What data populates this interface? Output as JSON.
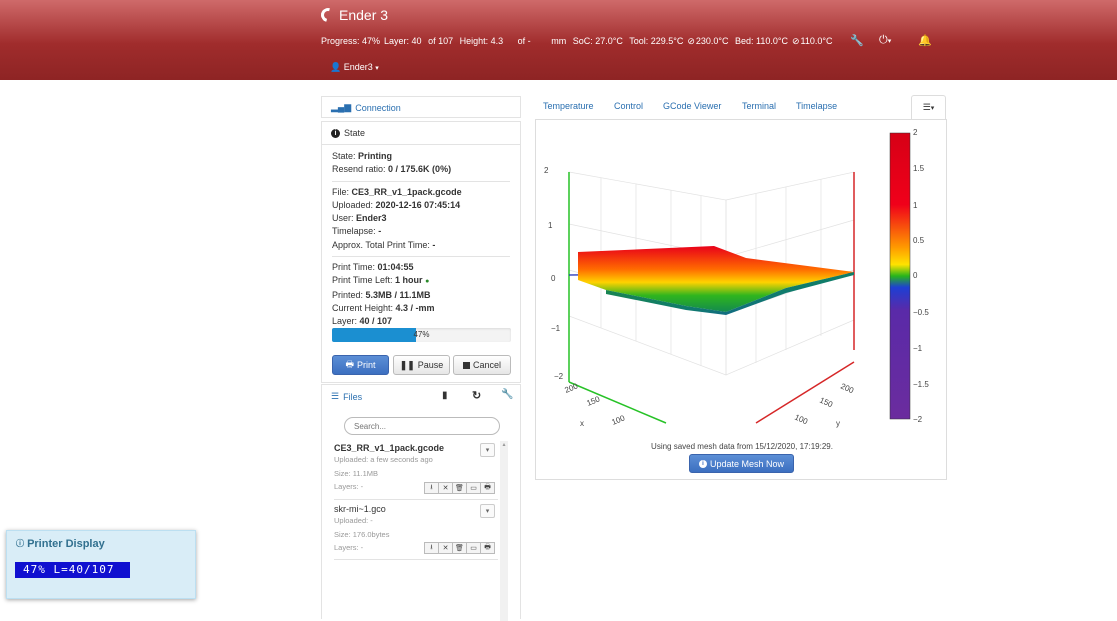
{
  "header": {
    "title": "Ender 3",
    "status": {
      "progress": "Progress: 47%",
      "layer": "Layer: 40",
      "of_layers": "of 107",
      "height": "Height: 4.3",
      "of_height": "of -",
      "unit": "mm",
      "soc": "SoC: 27.0°C",
      "tool": "Tool: 229.5°C",
      "tool_target": "230.0°C",
      "bed": "Bed: 110.0°C",
      "bed_target": "110.0°C"
    },
    "user": "Ender3"
  },
  "connection": {
    "title": "Connection"
  },
  "state": {
    "title": "State",
    "rows": [
      {
        "label": "State: ",
        "value": "Printing"
      },
      {
        "label": "Resend ratio: ",
        "value": "0 / 175.6K (0%)"
      },
      {
        "label": "File: ",
        "value": "CE3_RR_v1_1pack.gcode"
      },
      {
        "label": "Uploaded: ",
        "value": "2020-12-16 07:45:14"
      },
      {
        "label": "User: ",
        "value": "Ender3"
      },
      {
        "label": "Timelapse: ",
        "value": "-"
      },
      {
        "label": "Approx. Total Print Time: ",
        "value": "-"
      },
      {
        "label": "Print Time: ",
        "value": "01:04:55"
      },
      {
        "label": "Print Time Left: ",
        "value": "1 hour"
      },
      {
        "label": "Printed: ",
        "value": "5.3MB / 11.1MB"
      },
      {
        "label": "Current Height: ",
        "value": "4.3 / -mm"
      },
      {
        "label": "Layer: ",
        "value": "40 / 107"
      }
    ],
    "progress_percent": 47,
    "progress_label": "47%",
    "buttons": {
      "print": "Print",
      "pause": "Pause",
      "cancel": "Cancel"
    }
  },
  "files": {
    "title": "Files",
    "search_placeholder": "Search...",
    "items": [
      {
        "name": "CE3_RR_v1_1pack.gcode",
        "uploaded": "Uploaded: a few seconds ago",
        "size": "Size: 11.1MB",
        "layers": "Layers: -"
      },
      {
        "name": "skr-mi~1.gco",
        "uploaded": "Uploaded: -",
        "size": "Size: 176.0bytes",
        "layers": "Layers: -"
      }
    ]
  },
  "tabs": [
    "Temperature",
    "Control",
    "GCode Viewer",
    "Terminal",
    "Timelapse"
  ],
  "mesh": {
    "caption": "Using saved mesh data from 15/12/2020, 17:19:29.",
    "update_button": "Update Mesh Now",
    "colorbar_ticks": [
      "2",
      "1.5",
      "1",
      "0.5",
      "0",
      "−0.5",
      "−1",
      "−1.5",
      "−2"
    ],
    "z_ticks": [
      "2",
      "1",
      "0",
      "−1",
      "−2"
    ],
    "y_ticks": [
      "200",
      "150",
      "100"
    ],
    "x_ticks": [
      "200",
      "150",
      "100"
    ],
    "y_axis": "y",
    "x_axis": "x",
    "colors": {
      "high": "#e8001a",
      "mid": "#27a11b",
      "low": "#1a2bb5",
      "min": "#6b2c9e"
    }
  },
  "printer_display": {
    "title": "Printer Display",
    "lcd_text": "47% L=40/107"
  }
}
